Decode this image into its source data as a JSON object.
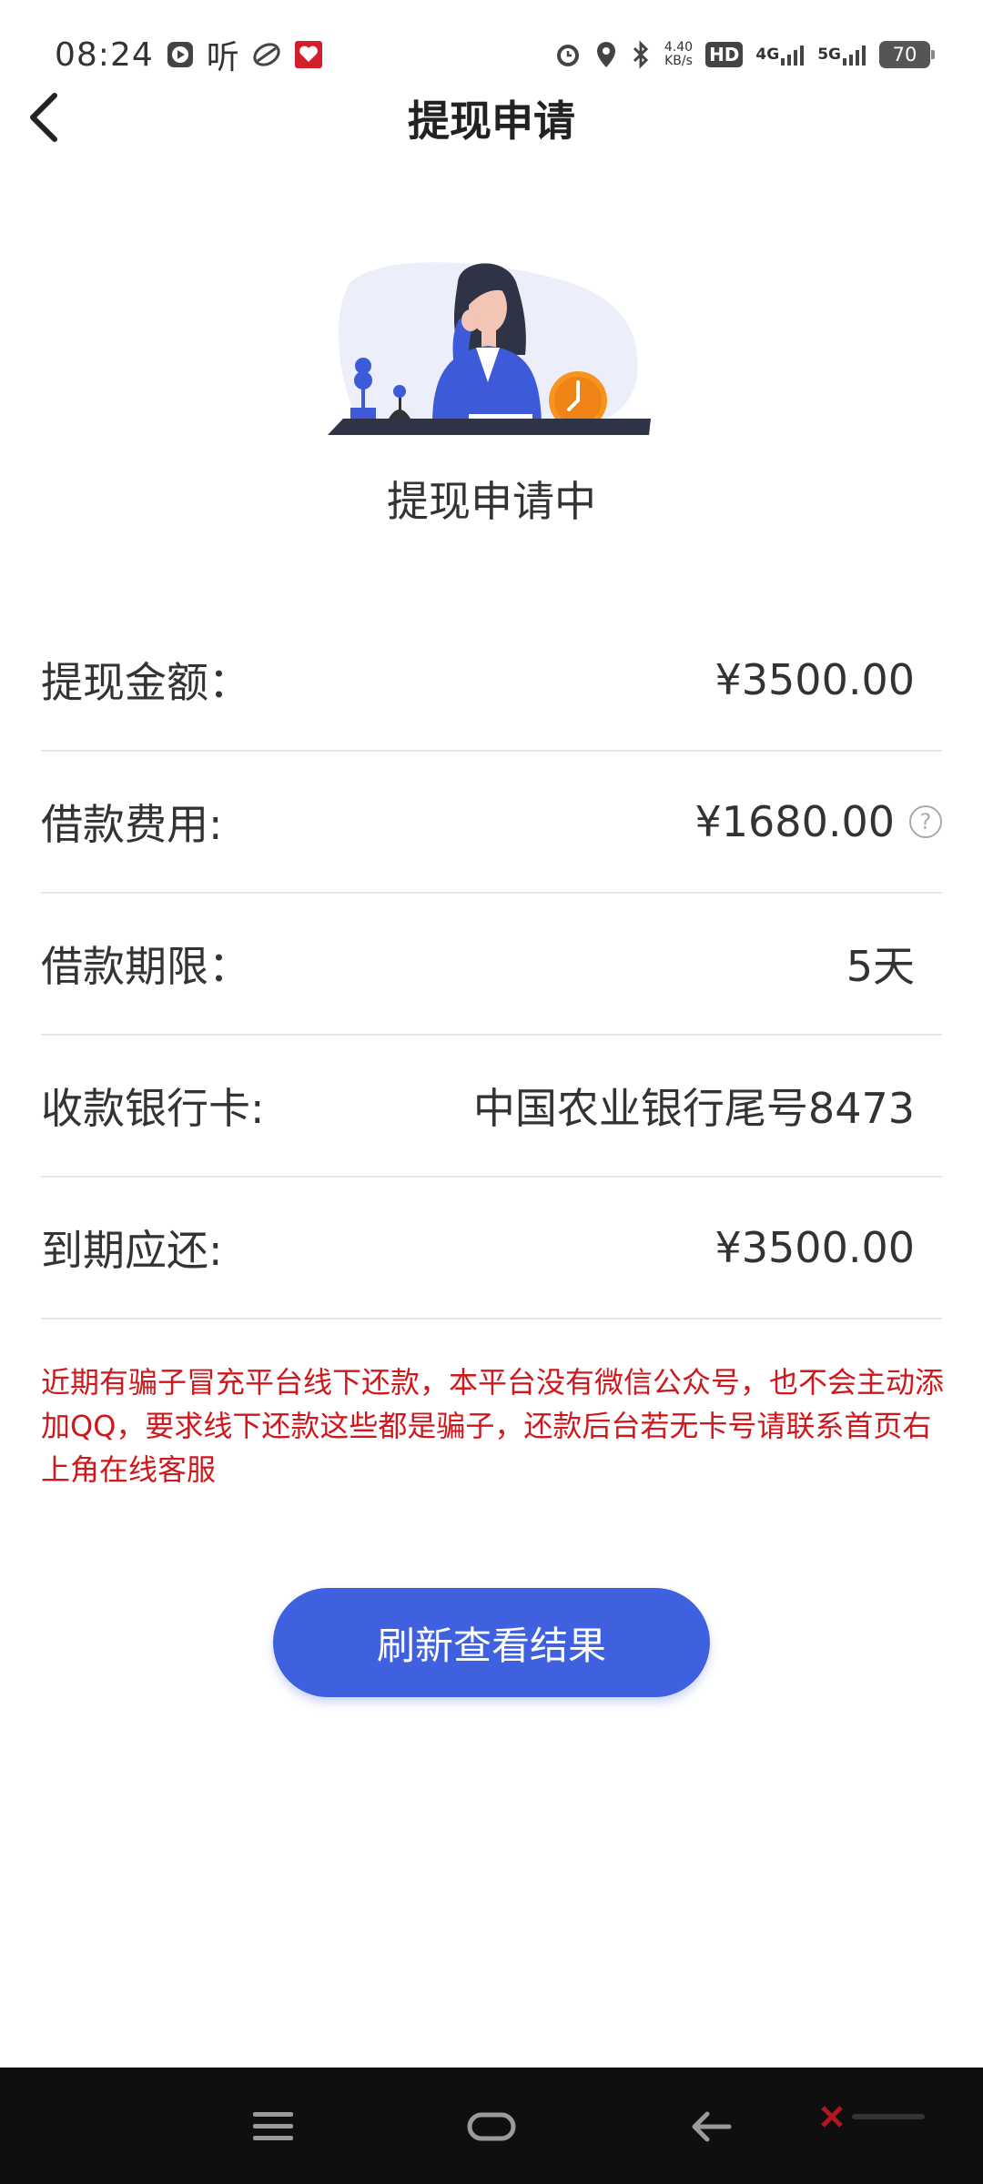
{
  "status_bar": {
    "time": "08:24",
    "listen_label": "听",
    "net_speed_value": "4.40",
    "net_speed_unit": "KB/s",
    "hd_label": "HD",
    "sim1": "4G",
    "sim2": "5G",
    "battery": "70"
  },
  "header": {
    "title": "提现申请"
  },
  "status_text": "提现申请中",
  "rows": [
    {
      "label": "提现金额：",
      "value": "¥3500.00"
    },
    {
      "label": "借款费用:",
      "value": "¥1680.00"
    },
    {
      "label": "借款期限：",
      "value": "5天"
    },
    {
      "label": "收款银行卡:",
      "value": "中国农业银行尾号8473"
    },
    {
      "label": "到期应还:",
      "value": "¥3500.00"
    }
  ],
  "help_icon_text": "?",
  "warning": "近期有骗子冒充平台线下还款，本平台没有微信公众号，也不会主动添加QQ，要求线下还款这些都是骗子，还款后台若无卡号请联系首页右上角在线客服",
  "refresh_button": "刷新查看结果",
  "colors": {
    "accent": "#3f61e0",
    "warning": "#d0171b",
    "nav_bg": "#0f0f0f"
  }
}
